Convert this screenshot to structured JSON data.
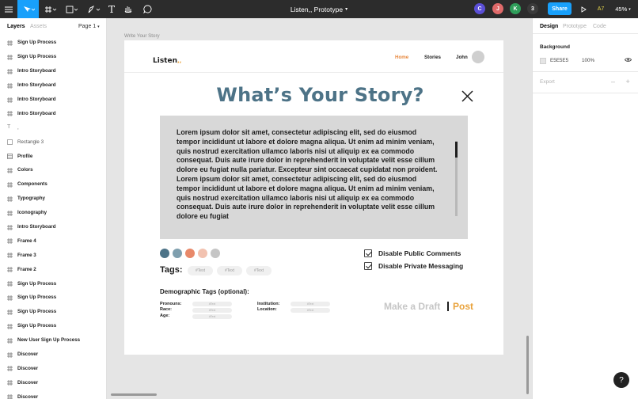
{
  "toolbar": {
    "file_title": "Listen,, Prototype",
    "share_label": "Share",
    "zoom": "45%",
    "plugin_badge": "A7",
    "collaborators": [
      {
        "initial": "C",
        "color": "#5b4fd6"
      },
      {
        "initial": "J",
        "color": "#e06a6a"
      },
      {
        "initial": "K",
        "color": "#2f9e5a"
      },
      {
        "initial": "3",
        "color": "#3a3a3a"
      }
    ]
  },
  "layers_panel": {
    "tab_layers": "Layers",
    "tab_assets": "Assets",
    "page_selector": "Page 1",
    "items": [
      {
        "label": "Sign Up Process",
        "kind": "frame"
      },
      {
        "label": "Sign Up Process",
        "kind": "frame"
      },
      {
        "label": "Intro Storyboard",
        "kind": "frame"
      },
      {
        "label": "Intro Storyboard",
        "kind": "frame"
      },
      {
        "label": "Intro Storyboard",
        "kind": "frame"
      },
      {
        "label": "Intro Storyboard",
        "kind": "frame"
      },
      {
        "label": ",",
        "kind": "text"
      },
      {
        "label": "Rectangle 3",
        "kind": "rect"
      },
      {
        "label": "Profile",
        "kind": "component"
      },
      {
        "label": "Colors",
        "kind": "frame"
      },
      {
        "label": "Components",
        "kind": "frame"
      },
      {
        "label": "Typography",
        "kind": "frame"
      },
      {
        "label": "Iconography",
        "kind": "frame"
      },
      {
        "label": "Intro Storyboard",
        "kind": "frame"
      },
      {
        "label": "Frame 4",
        "kind": "frame"
      },
      {
        "label": "Frame 3",
        "kind": "frame"
      },
      {
        "label": "Frame 2",
        "kind": "frame"
      },
      {
        "label": "Sign Up Process",
        "kind": "frame"
      },
      {
        "label": "Sign Up Process",
        "kind": "frame"
      },
      {
        "label": "Sign Up Process",
        "kind": "frame"
      },
      {
        "label": "Sign Up Process",
        "kind": "frame"
      },
      {
        "label": "New User Sign Up Process",
        "kind": "frame"
      },
      {
        "label": "Discover",
        "kind": "frame"
      },
      {
        "label": "Discover",
        "kind": "frame"
      },
      {
        "label": "Discover",
        "kind": "frame"
      },
      {
        "label": "Discover",
        "kind": "frame"
      }
    ]
  },
  "design_panel": {
    "tab_design": "Design",
    "tab_prototype": "Prototype",
    "tab_code": "Code",
    "background_label": "Background",
    "background_hex": "E5E5E5",
    "background_opacity": "100%",
    "export_label": "Export",
    "help_label": "?"
  },
  "canvas": {
    "frame_label": "Write Your Story",
    "frame": {
      "logo": "Listen",
      "logo_accent": ",,",
      "nav_home": "Home",
      "nav_stories": "Stories",
      "nav_user": "John",
      "title": "What’s Your Story?",
      "body_text": "Lorem ipsum dolor sit amet, consectetur adipiscing elit, sed do eiusmod tempor incididunt ut labore et dolore magna aliqua. Ut enim ad minim veniam, quis nostrud exercitation ullamco laboris nisi ut aliquip ex ea commodo consequat. Duis aute irure dolor in reprehenderit in voluptate velit esse cillum dolore eu fugiat nulla pariatur. Excepteur sint occaecat cupidatat non proident. Lorem ipsum dolor sit amet, consectetur adipiscing elit, sed do eiusmod tempor incididunt ut labore et dolore magna aliqua. Ut enim ad minim veniam, quis nostrud exercitation ullamco laboris nisi ut aliquip ex ea commodo consequat. Duis aute irure dolor in reprehenderit in voluptate velit esse cillum dolore eu fugiat",
      "color_swatches": [
        "#4d7387",
        "#7f9fae",
        "#e8896a",
        "#f2c2b0",
        "#c5c5c5"
      ],
      "tags_label": "Tags:",
      "tags": [
        "#Text",
        "#Text",
        "#Text"
      ],
      "checkbox_public": "Disable Public Comments",
      "checkbox_private": "Disable Private Messaging",
      "demographic_title": "Demographic Tags (optional):",
      "demo_pronouns": "Pronouns:",
      "demo_race": "Race:",
      "demo_age": "Age:",
      "demo_institution": "Institution:",
      "demo_location": "Location:",
      "demo_placeholder": "#Text",
      "draft_label": "Make a Draft",
      "post_label": "Post"
    }
  }
}
